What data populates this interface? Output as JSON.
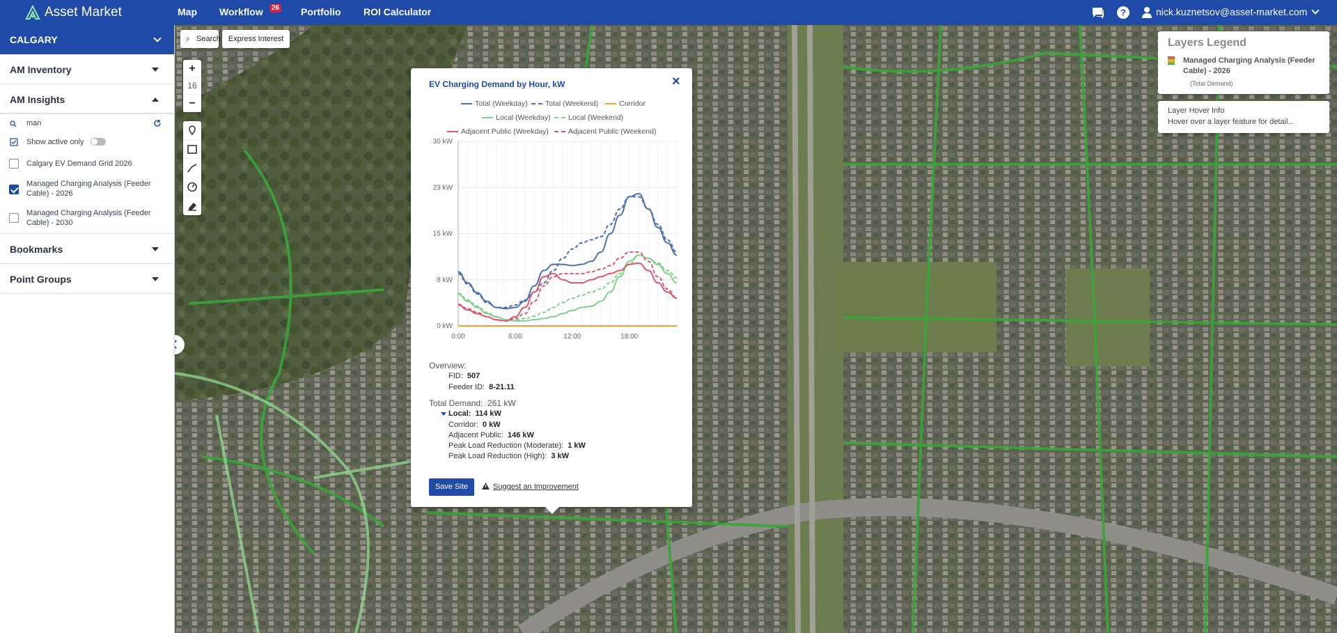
{
  "header": {
    "brand": "Asset Market",
    "nav": [
      {
        "label": "Map"
      },
      {
        "label": "Workflow",
        "badge": "26"
      },
      {
        "label": "Portfolio"
      },
      {
        "label": "ROI Calculator"
      }
    ],
    "user": "nick.kuznetsov@asset-market.com"
  },
  "sidebar": {
    "city": "CALGARY",
    "inventory": "AM Inventory",
    "insights": "AM Insights",
    "search_value": "man",
    "show_active": "Show active only",
    "layers": [
      {
        "label": "Calgary EV Demand Grid 2026",
        "checked": false
      },
      {
        "label": "Managed Charging Analysis (Feeder Cable) - 2026",
        "checked": true
      },
      {
        "label": "Managed Charging Analysis (Feeder Cable) - 2030",
        "checked": false
      }
    ],
    "bookmarks": "Bookmarks",
    "point_groups": "Point Groups"
  },
  "map": {
    "search_label": "Search",
    "express_label": "Express Interest",
    "zoom_level": "16",
    "zoom_in": "+",
    "zoom_out": "−"
  },
  "legend": {
    "title": "Layers Legend",
    "layer": "Managed Charging Analysis (Feeder Cable) - 2026",
    "sub": "(Total Demand)"
  },
  "hover": {
    "title": "Layer Hover Info",
    "text": "Hover over a layer feature for detail..."
  },
  "popup": {
    "title": "EV Charging Demand by Hour, kW",
    "close": "×",
    "overview_label": "Overview:",
    "fid_label": "FID:",
    "fid": "507",
    "feeder_label": "Feeder ID:",
    "feeder": "8-21.11",
    "total_label": "Total Demand:",
    "total": "261 kW",
    "local_label": "Local:",
    "local": "114 kW",
    "corridor_label": "Corridor:",
    "corridor": "0 kW",
    "adjacent_label": "Adjacent Public:",
    "adjacent": "146 kW",
    "plr_mod_label": "Peak Load Reduction (Moderate):",
    "plr_mod": "1 kW",
    "plr_high_label": "Peak Load Reduction (High):",
    "plr_high": "3 kW",
    "save": "Save Site",
    "suggest": "Suggest an Improvement"
  },
  "chart_data": {
    "type": "line",
    "title": "EV Charging Demand by Hour, kW",
    "x": [
      0,
      1,
      2,
      3,
      4,
      5,
      6,
      7,
      8,
      9,
      10,
      11,
      12,
      13,
      14,
      15,
      16,
      17,
      18,
      19,
      20,
      21,
      22,
      23
    ],
    "xticks": [
      "0:00",
      "6:00",
      "12:00",
      "18:00"
    ],
    "yticks": [
      "0 kW",
      "8 kW",
      "15 kW",
      "23 kW",
      "30 kW"
    ],
    "ylim": [
      0,
      30
    ],
    "legend_position": "top",
    "series": [
      {
        "name": "Total (Weekday)",
        "color": "#4a6fb0",
        "dash": false,
        "values": [
          8.8,
          7,
          5.4,
          4,
          3,
          2.8,
          3,
          4,
          6.5,
          9,
          10,
          10,
          9.8,
          10,
          10.5,
          12,
          15,
          18,
          21,
          21.5,
          19,
          16,
          13.5,
          11.5
        ]
      },
      {
        "name": "Total (Weekend)",
        "color": "#4a6fb0",
        "dash": true,
        "values": [
          8.5,
          6.8,
          5.2,
          3.8,
          3,
          3,
          3.4,
          4.2,
          5.5,
          7,
          9,
          11,
          12.5,
          13.5,
          14,
          14.5,
          16.5,
          19,
          21,
          21,
          19,
          16.5,
          14,
          12
        ]
      },
      {
        "name": "Corridor",
        "color": "#f0a030",
        "dash": false,
        "values": [
          0,
          0,
          0,
          0,
          0,
          0,
          0,
          0,
          0,
          0,
          0,
          0,
          0,
          0,
          0,
          0,
          0,
          0,
          0,
          0,
          0,
          0,
          0,
          0
        ]
      },
      {
        "name": "Local (Weekday)",
        "color": "#7fcf8a",
        "dash": false,
        "values": [
          5.2,
          4,
          3,
          2,
          1.5,
          1,
          0.8,
          0.8,
          1,
          1.2,
          1.5,
          2,
          2.5,
          3,
          3.2,
          4,
          5.5,
          8,
          10.5,
          11.5,
          11,
          10,
          8.5,
          7
        ]
      },
      {
        "name": "Local (Weekend)",
        "color": "#7fcf8a",
        "dash": true,
        "values": [
          5.3,
          4.2,
          3.2,
          2.2,
          1.5,
          1,
          1,
          1.2,
          1.6,
          2.2,
          3,
          3.8,
          4.5,
          5,
          5.5,
          6,
          7,
          8.5,
          10,
          11.5,
          11,
          10.2,
          9,
          7.8
        ]
      },
      {
        "name": "Adjacent Public (Weekday)",
        "color": "#d9576b",
        "dash": false,
        "values": [
          3.4,
          2.6,
          2,
          1.5,
          1,
          0.8,
          1.5,
          3,
          5.5,
          8,
          8.5,
          7.5,
          7,
          7,
          7.5,
          8,
          8.5,
          9,
          10,
          10.2,
          9,
          7,
          5.5,
          4.5
        ]
      },
      {
        "name": "Adjacent Public (Weekend)",
        "color": "#d9576b",
        "dash": true,
        "values": [
          3.5,
          2.8,
          2.2,
          1.5,
          1,
          0.8,
          1.2,
          2,
          4,
          6.5,
          8,
          8.5,
          8.5,
          8.5,
          8.8,
          9.2,
          9.8,
          11,
          12,
          12,
          10.5,
          8,
          6,
          4.5
        ]
      }
    ]
  }
}
